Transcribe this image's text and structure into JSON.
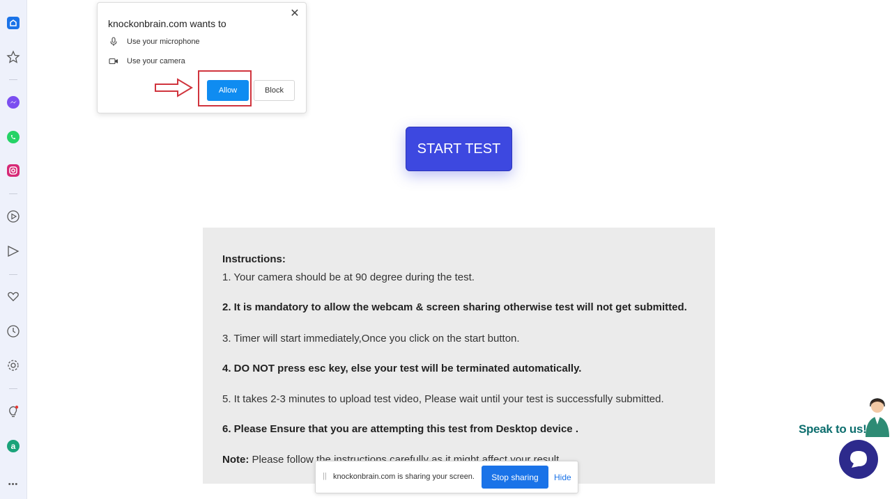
{
  "sidebar": {
    "items": [
      {
        "name": "home-icon"
      },
      {
        "name": "star-icon"
      },
      {
        "name": "messenger-icon"
      },
      {
        "name": "whatsapp-icon"
      },
      {
        "name": "instagram-icon"
      },
      {
        "name": "play-circle-icon"
      },
      {
        "name": "send-icon"
      },
      {
        "name": "heart-icon"
      },
      {
        "name": "clock-icon"
      },
      {
        "name": "settings-icon"
      },
      {
        "name": "bulb-icon"
      },
      {
        "name": "aria-icon"
      },
      {
        "name": "more-icon"
      }
    ],
    "more_label": "•••"
  },
  "permission": {
    "title": "knockonbrain.com wants to",
    "microphone": "Use your microphone",
    "camera": "Use your camera",
    "allow": "Allow",
    "block": "Block",
    "close": "✕"
  },
  "start_button": "START TEST",
  "instructions": {
    "heading": "Instructions:",
    "line1": "1. Your camera should be at 90 degree during the test.",
    "line2": "2. It is mandatory to allow the webcam & screen sharing otherwise test will not get submitted.",
    "line3": "3. Timer will start immediately,Once you click on the start button.",
    "line4": "4. DO NOT press esc key, else your test will be terminated automatically.",
    "line5": "5. It takes 2-3 minutes to upload test video, Please wait until your test is successfully submitted.",
    "line6": "6. Please Ensure that you are attempting this test from Desktop device .",
    "note_label": "Note:",
    "note_text": " Please follow the instructions carefully as it might affect your result."
  },
  "share_bar": {
    "grip": "||",
    "text": "knockonbrain.com is sharing your screen.",
    "stop": "Stop sharing",
    "hide": "Hide"
  },
  "speak": {
    "label": "Speak to us!"
  },
  "colors": {
    "accent": "#3d48e0",
    "allow_blue": "#0f8cf1",
    "share_blue": "#1a73e8",
    "highlight_red": "#d0343d",
    "speak_teal": "#0d6e6e",
    "chat_navy": "#2d2a8c"
  }
}
